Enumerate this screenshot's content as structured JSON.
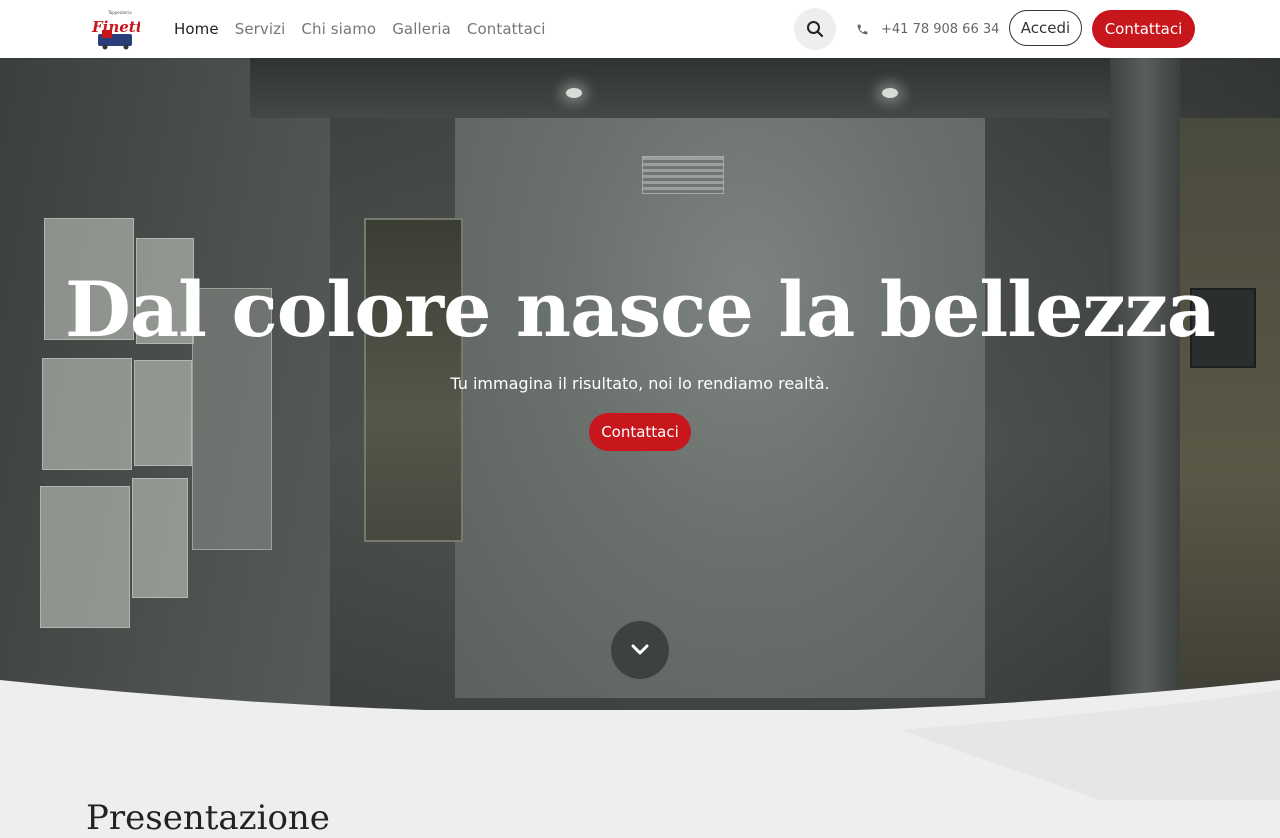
{
  "brand": {
    "logo_text": "Finetti",
    "logo_tagline": "Tappezzeria",
    "accent_color": "#c8161d"
  },
  "nav": {
    "items": [
      {
        "label": "Home",
        "active": true
      },
      {
        "label": "Servizi",
        "active": false
      },
      {
        "label": "Chi siamo",
        "active": false
      },
      {
        "label": "Galleria",
        "active": false
      },
      {
        "label": "Contattaci",
        "active": false
      }
    ]
  },
  "header": {
    "search_icon": "search-icon",
    "phone_icon": "phone-icon",
    "phone": "+41 78 908 66 34",
    "login_label": "Accedi",
    "contact_label": "Contattaci"
  },
  "hero": {
    "title": "Dal colore nasce la bellezza",
    "subtitle": "Tu immagina il risultato, noi lo rendiamo realtà.",
    "cta_label": "Contattaci",
    "scroll_icon": "chevron-down-icon"
  },
  "section": {
    "title": "Presentazione"
  }
}
